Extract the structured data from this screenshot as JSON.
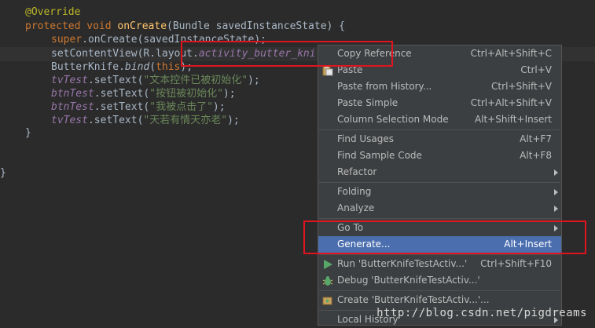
{
  "editor": {
    "code": {
      "annotation": "@Override",
      "sig_kw": "protected void ",
      "sig_method": "onCreate",
      "sig_rest": "(Bundle savedInstanceState) {",
      "super_kw": "super",
      "super_rest": ".onCreate(savedInstanceState);",
      "setcv_pre": "setContentView(R.layout.",
      "setcv_field": "activity_butter_kni",
      "bk_pre": "ButterKnife.",
      "bk_method": "bind",
      "bk_open": "(",
      "bk_this": "this",
      "bk_close": ");",
      "tv_var": "tvTest",
      "tv_mid": ".setText(",
      "tv_str": "\"文本控件已被初始化\"",
      "btn_var": "btnTest",
      "btn_mid": ".setText(",
      "btn_str1": "\"按钮被初始化\"",
      "btn_str2": "\"我被点击了\"",
      "tv2_str": "\"天若有情天亦老\"",
      "end_paren": ");",
      "close_brace": "}"
    }
  },
  "context_menu": {
    "items": [
      {
        "label": "Copy Reference",
        "shortcut": "Ctrl+Alt+Shift+C"
      },
      {
        "label": "Paste",
        "shortcut": "Ctrl+V"
      },
      {
        "label": "Paste from History...",
        "shortcut": "Ctrl+Shift+V"
      },
      {
        "label": "Paste Simple",
        "shortcut": "Ctrl+Alt+Shift+V"
      },
      {
        "label": "Column Selection Mode",
        "shortcut": "Alt+Shift+Insert"
      },
      {
        "label": "Find Usages",
        "shortcut": "Alt+F7"
      },
      {
        "label": "Find Sample Code",
        "shortcut": "Alt+F8"
      },
      {
        "label": "Refactor",
        "shortcut": ""
      },
      {
        "label": "Folding",
        "shortcut": ""
      },
      {
        "label": "Analyze",
        "shortcut": ""
      },
      {
        "label": "Go To",
        "shortcut": ""
      },
      {
        "label": "Generate...",
        "shortcut": "Alt+Insert"
      },
      {
        "label": "Run 'ButterKnifeTestActiv...'",
        "shortcut": "Ctrl+Shift+F10"
      },
      {
        "label": "Debug 'ButterKnifeTestActiv...'",
        "shortcut": ""
      },
      {
        "label": "Create 'ButterKnifeTestActiv...'...",
        "shortcut": ""
      },
      {
        "label": "Local History",
        "shortcut": ""
      }
    ]
  },
  "icons": {
    "paste": "paste-icon",
    "run": "run-icon",
    "debug": "debug-icon",
    "create": "create-config-icon"
  },
  "colors": {
    "background": "#2b2b2b",
    "menu_bg": "#3c3f41",
    "selected": "#4b6eaf",
    "highlight_box": "#e0141e",
    "run_green": "#59a869"
  },
  "watermark": "http://blog.csdn.net/pigdreams"
}
